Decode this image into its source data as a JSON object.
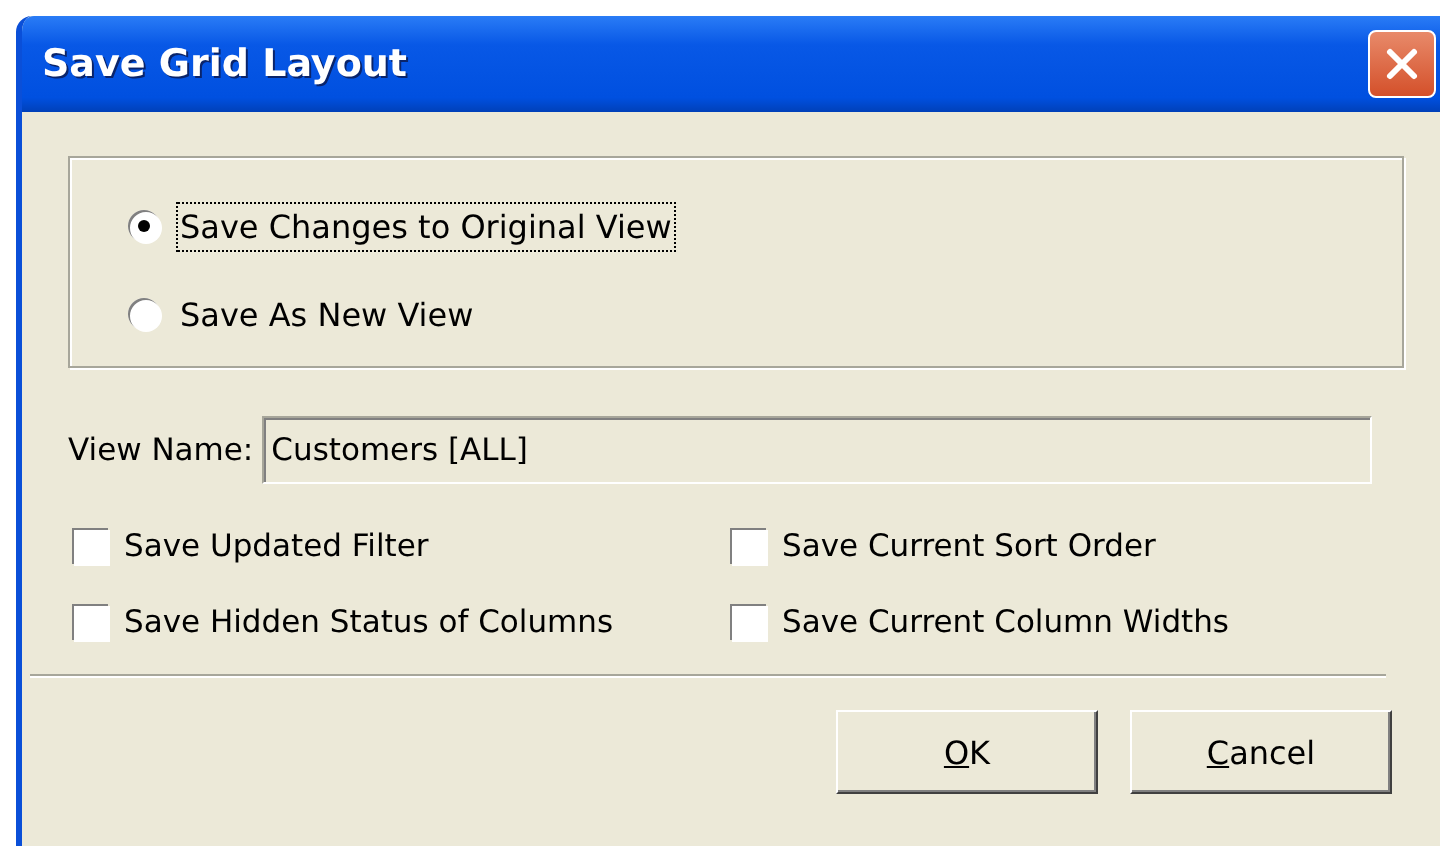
{
  "window": {
    "title": "Save Grid Layout"
  },
  "save_mode": [
    {
      "label": "Save Changes to Original View",
      "selected": true,
      "focused": true
    },
    {
      "label": "Save As New View",
      "selected": false,
      "focused": false
    }
  ],
  "view_name": {
    "label": "View Name:",
    "value": "Customers [ALL]"
  },
  "options": [
    {
      "label": "Save Updated Filter",
      "checked": false
    },
    {
      "label": "Save Current Sort Order",
      "checked": false
    },
    {
      "label": "Save Hidden Status of Columns",
      "checked": false
    },
    {
      "label": "Save Current Column Widths",
      "checked": false
    }
  ],
  "buttons": [
    {
      "label": "OK"
    },
    {
      "label": "Cancel"
    }
  ]
}
